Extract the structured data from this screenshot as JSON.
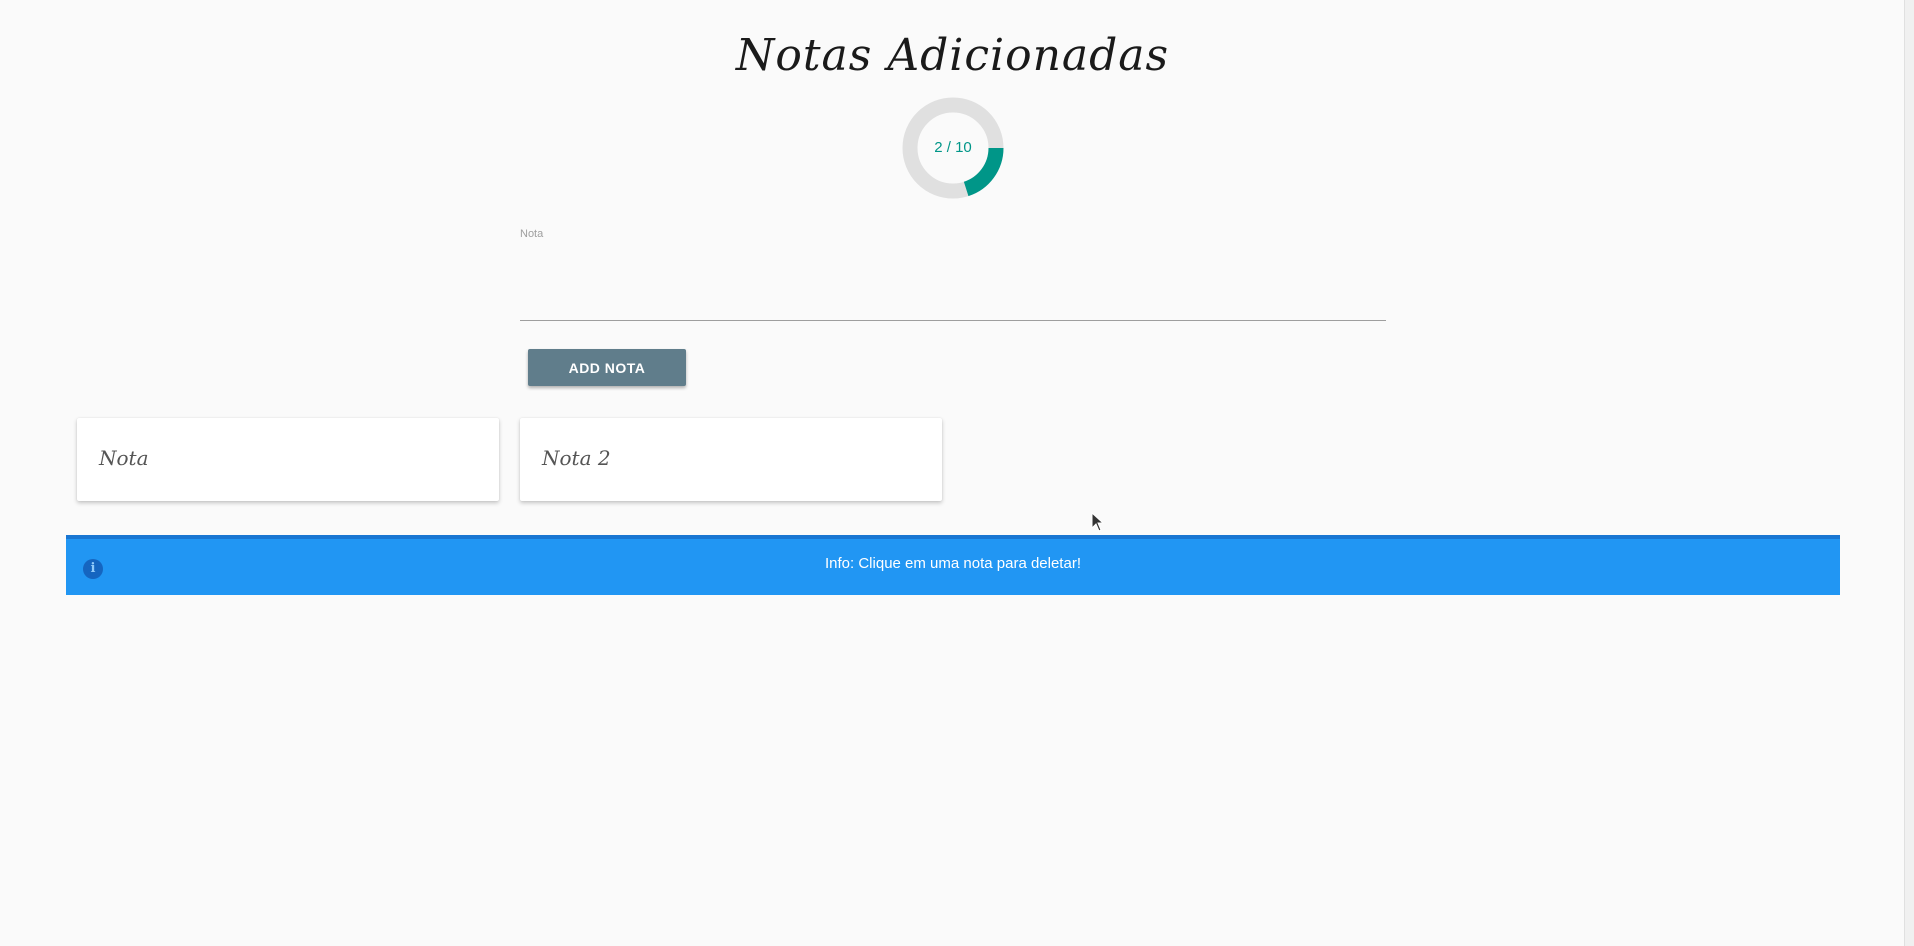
{
  "page": {
    "title": "Notas Adicionadas"
  },
  "progress": {
    "current": 2,
    "max": 10,
    "label": "2 / 10",
    "track_color": "#e0e0e0",
    "fill_color": "#009688"
  },
  "form": {
    "field_label": "Nota",
    "field_value": "",
    "add_button_label": "ADD NOTA",
    "button_color": "#607d8b"
  },
  "notes": [
    {
      "text": "Nota"
    },
    {
      "text": "Nota 2"
    }
  ],
  "info": {
    "icon": "info-icon",
    "message": "Info: Clique em uma nota para deletar!",
    "color": "#2196f3"
  }
}
